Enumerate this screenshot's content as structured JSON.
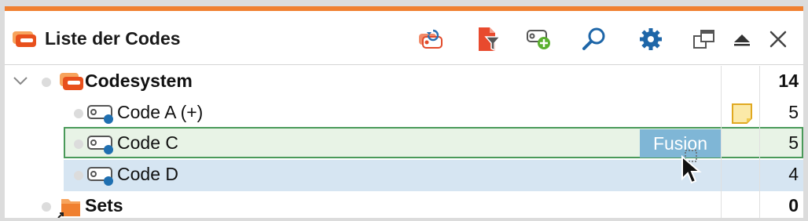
{
  "window": {
    "title": "Liste der Codes",
    "accent_color": "#f08030"
  },
  "toolbar": {
    "buttons": [
      {
        "name": "reset-activation-icon"
      },
      {
        "name": "filter-document-icon"
      },
      {
        "name": "new-code-icon"
      },
      {
        "name": "search-icon"
      },
      {
        "name": "settings-gear-icon"
      },
      {
        "name": "undock-window-icon"
      },
      {
        "name": "collapse-up-icon"
      },
      {
        "name": "close-icon"
      }
    ]
  },
  "tree": {
    "rows": [
      {
        "label": "Codesystem",
        "count": "14",
        "bold": true,
        "icon": "codesystem-icon"
      },
      {
        "label": "Code A (+)",
        "count": "5",
        "bold": false,
        "icon": "code-tag-icon",
        "has_memo": true
      },
      {
        "label": "Code C",
        "count": "5",
        "bold": false,
        "icon": "code-tag-icon",
        "selected": "drop-target"
      },
      {
        "label": "Code D",
        "count": "4",
        "bold": false,
        "icon": "code-tag-icon",
        "selected": "dragging"
      },
      {
        "label": "Sets",
        "count": "0",
        "bold": true,
        "icon": "sets-folder-icon"
      }
    ]
  },
  "drag_hint": {
    "label": "Fusion"
  },
  "colors": {
    "code_dot": "#1f6fb0",
    "drop_target_bg": "#e8f3e6",
    "drop_target_border": "#4a9a5a",
    "dragging_bg": "#d6e5f2",
    "fusion_bg": "#7fb6d6",
    "memo_fill": "#fbe9a8"
  }
}
